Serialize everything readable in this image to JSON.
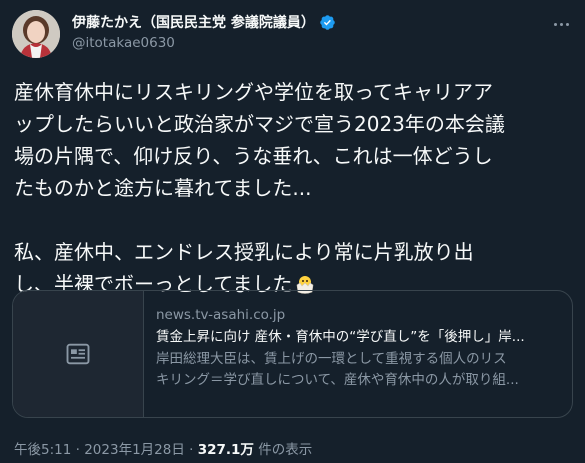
{
  "author": {
    "display_name": "伊藤たかえ（国民民主党 参議院議員）",
    "handle": "@itotakae0630"
  },
  "icons": {
    "verified": "verified-badge-icon",
    "more": "more-options-icon",
    "card_placeholder": "article-placeholder-icon",
    "emoji": "hatching-chick-emoji"
  },
  "tweet": {
    "lines": [
      "産休育休中にリスキリングや学位を取ってキャリアア",
      "ップしたらいいと政治家がマジで宣う2023年の本会議",
      "場の片隅で、仰け反り、うな垂れ、これは一体どうし",
      "たものかと途方に暮れてました...",
      "私、産休中、エンドレス授乳により常に片乳放り出",
      "し、半裸でボーっとしてました"
    ]
  },
  "card": {
    "domain": "news.tv-asahi.co.jp",
    "title": "賃金上昇に向け 産休・育休中の“学び直し”を「後押し」岸...",
    "desc_lines": [
      "岸田総理大臣は、賃上げの一環として重視する個人のリス",
      "キリング＝学び直しについて、産休や育休中の人が取り組..."
    ]
  },
  "meta": {
    "time": "午後5:11",
    "separator": "·",
    "date": "2023年1月28日",
    "views_count": "327.1万",
    "views_label": "件の表示"
  },
  "colors": {
    "background": "#15202b",
    "text_primary": "#f7f9f9",
    "text_secondary": "#8b98a5",
    "verified": "#1d9bf0",
    "border": "#38444d"
  }
}
